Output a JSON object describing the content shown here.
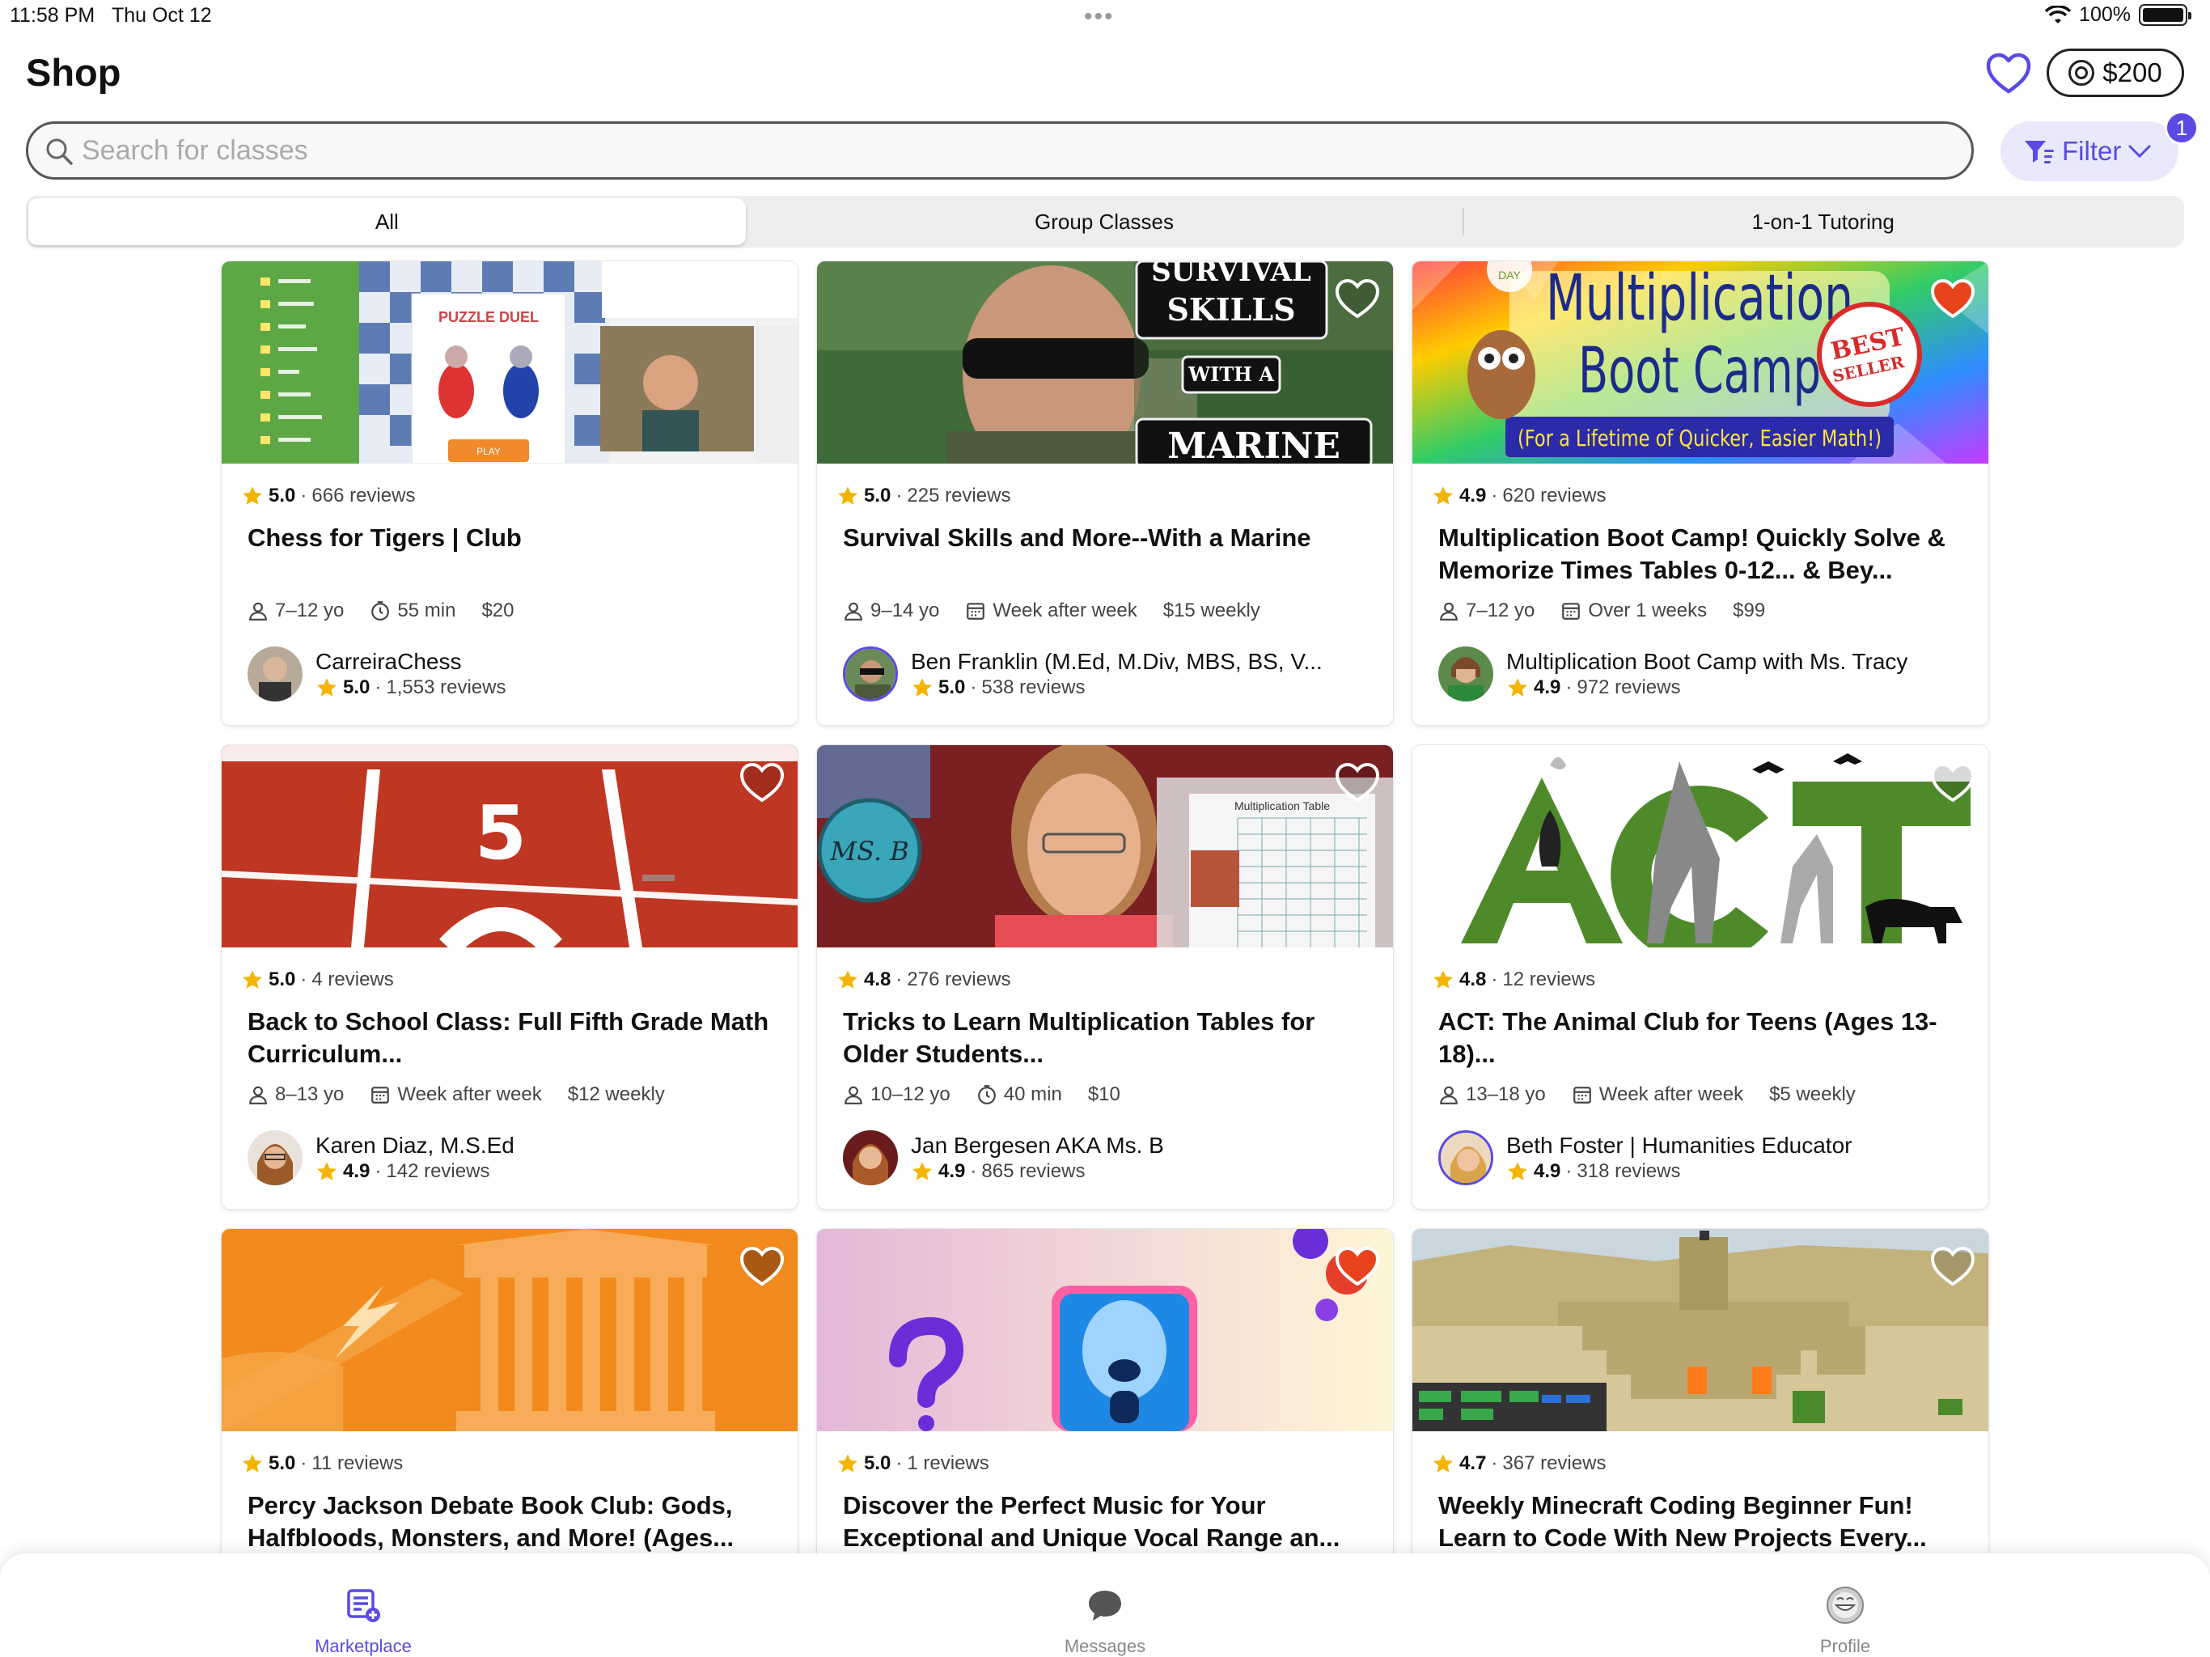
{
  "status": {
    "time": "11:58 PM",
    "date": "Thu Oct 12",
    "battery": "100%",
    "battery_level": 1.0
  },
  "header": {
    "title": "Shop",
    "balance": "$200"
  },
  "search": {
    "placeholder": "Search for classes",
    "value": ""
  },
  "filter": {
    "label": "Filter",
    "badge": "1"
  },
  "tabs": [
    {
      "label": "All",
      "active": true
    },
    {
      "label": "Group Classes",
      "active": false
    },
    {
      "label": "1-on-1 Tutoring",
      "active": false
    }
  ],
  "cards": [
    {
      "rating": "5.0",
      "reviews": "666 reviews",
      "title": "Chess for Tigers | Club",
      "age": "7–12 yo",
      "schedule": "55 min",
      "schedule_icon": "clock-icon",
      "price": "$20",
      "teacher": "CarreiraChess",
      "teacher_rating": "5.0",
      "teacher_reviews": "1,553 reviews",
      "favorited": false
    },
    {
      "rating": "5.0",
      "reviews": "225 reviews",
      "title": "Survival Skills and More--With a Marine",
      "age": "9–14 yo",
      "schedule": "Week after week",
      "schedule_icon": "calendar-icon",
      "price": "$15 weekly",
      "teacher": "Ben Franklin (M.Ed, M.Div, MBS, BS, V...",
      "teacher_rating": "5.0",
      "teacher_reviews": "538 reviews",
      "favorited": false,
      "thumb_text": [
        "SURVIVAL",
        "SKILLS",
        "WITH A",
        "MARINE"
      ]
    },
    {
      "rating": "4.9",
      "reviews": "620 reviews",
      "title": "Multiplication Boot Camp! Quickly Solve & Memorize Times Tables 0-12... & Bey...",
      "age": "7–12 yo",
      "schedule": "Over 1 weeks",
      "schedule_icon": "calendar-icon",
      "price": "$99",
      "teacher": "Multiplication Boot Camp with Ms. Tracy",
      "teacher_rating": "4.9",
      "teacher_reviews": "972 reviews",
      "favorited": true,
      "thumb_text": [
        "Multiplication",
        "Boot Camp",
        "(For a Lifetime of Quicker, Easier Math!)",
        "BEST SELLER"
      ]
    },
    {
      "rating": "5.0",
      "reviews": "4 reviews",
      "title": "Back to School Class: Full Fifth Grade Math Curriculum...",
      "age": "8–13 yo",
      "schedule": "Week after week",
      "schedule_icon": "calendar-icon",
      "price": "$12 weekly",
      "teacher": "Karen Diaz, M.S.Ed",
      "teacher_rating": "4.9",
      "teacher_reviews": "142 reviews",
      "favorited": false
    },
    {
      "rating": "4.8",
      "reviews": "276 reviews",
      "title": "Tricks to Learn Multiplication Tables for Older Students...",
      "age": "10–12 yo",
      "schedule": "40 min",
      "schedule_icon": "clock-icon",
      "price": "$10",
      "teacher": "Jan Bergesen AKA Ms. B",
      "teacher_rating": "4.9",
      "teacher_reviews": "865 reviews",
      "favorited": false,
      "thumb_text": [
        "MS. B",
        "Multiplication Table"
      ]
    },
    {
      "rating": "4.8",
      "reviews": "12 reviews",
      "title": "ACT: The Animal Club for Teens (Ages 13-18)...",
      "age": "13–18 yo",
      "schedule": "Week after week",
      "schedule_icon": "calendar-icon",
      "price": "$5 weekly",
      "teacher": "Beth Foster | Humanities Educator",
      "teacher_rating": "4.9",
      "teacher_reviews": "318 reviews",
      "favorited": false
    },
    {
      "rating": "5.0",
      "reviews": "11 reviews",
      "title": "Percy Jackson Debate Book Club: Gods, Halfbloods, Monsters, and More! (Ages...",
      "favorited": true
    },
    {
      "rating": "5.0",
      "reviews": "1 reviews",
      "title": "Discover the Perfect Music for Your Exceptional and Unique Vocal Range an...",
      "favorited": true
    },
    {
      "rating": "4.7",
      "reviews": "367 reviews",
      "title": "Weekly Minecraft Coding Beginner Fun! Learn to Code With New Projects Every...",
      "favorited": false
    }
  ],
  "tabbar": [
    {
      "label": "Marketplace",
      "icon": "marketplace-icon",
      "active": true
    },
    {
      "label": "Messages",
      "icon": "messages-icon",
      "active": false
    },
    {
      "label": "Profile",
      "icon": "profile-avatar-icon",
      "active": false
    }
  ],
  "colors": {
    "accent": "#5a4ae3",
    "star": "#f5b400",
    "heart_filled": "#e8431c"
  }
}
